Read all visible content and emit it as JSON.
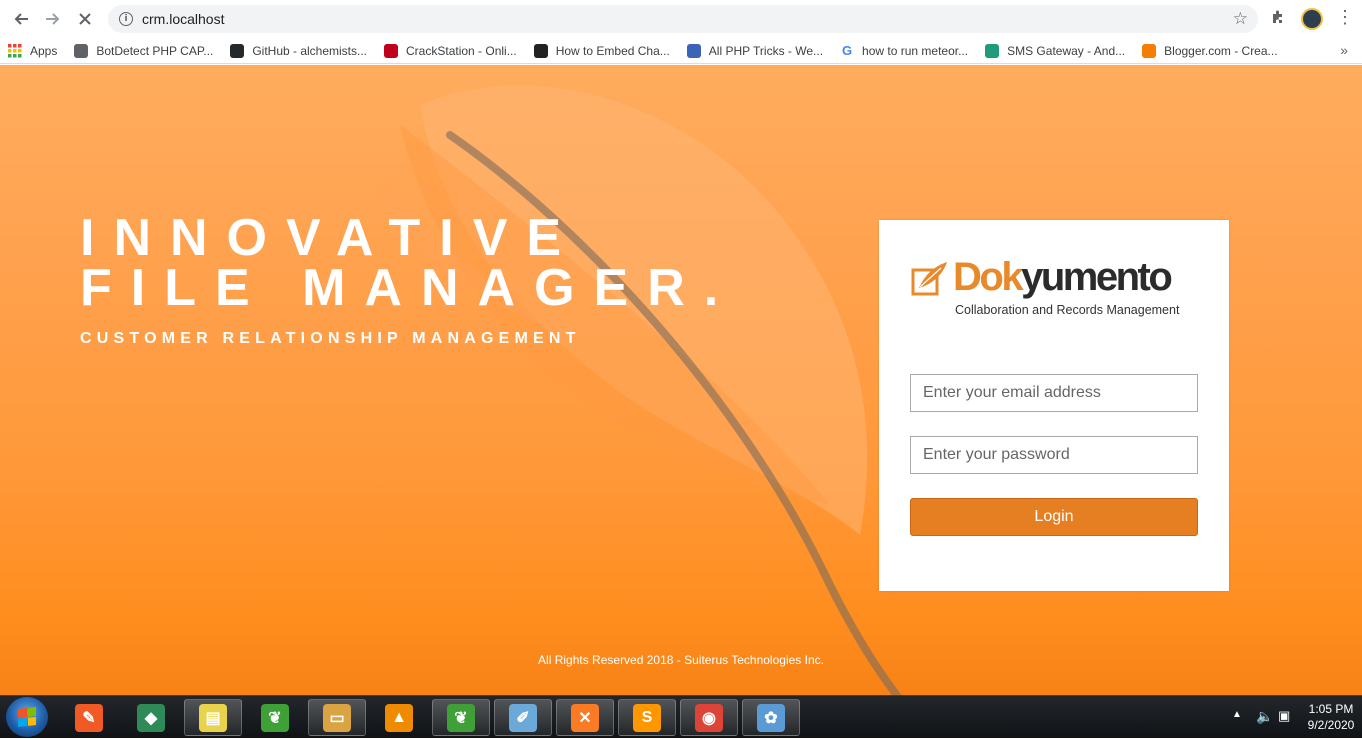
{
  "browser": {
    "url": "crm.localhost",
    "bookmarks": [
      {
        "label": "Apps",
        "icon": "apps-grid-icon",
        "color": "#4285f4"
      },
      {
        "label": "BotDetect PHP CAP...",
        "icon": "globe-icon",
        "color": "#5f6368"
      },
      {
        "label": "GitHub - alchemists...",
        "icon": "github-icon",
        "color": "#24292e"
      },
      {
        "label": "CrackStation - Onli...",
        "icon": "crackstation-icon",
        "color": "#c0001a"
      },
      {
        "label": "How to Embed Cha...",
        "icon": "chart-site-icon",
        "color": "#222222"
      },
      {
        "label": "All PHP Tricks - We...",
        "icon": "php-icon",
        "color": "#3b64b8"
      },
      {
        "label": "how to run meteor...",
        "icon": "google-icon",
        "color": "#4285f4"
      },
      {
        "label": "SMS Gateway - And...",
        "icon": "sms-gateway-icon",
        "color": "#1e9b7b"
      },
      {
        "label": "Blogger.com - Crea...",
        "icon": "blogger-icon",
        "color": "#f57d00"
      }
    ],
    "more_bookmarks": "»"
  },
  "hero": {
    "title_line1": "INNOVATIVE",
    "title_line2": "FILE MANAGER.",
    "subtitle": "CUSTOMER RELATIONSHIP MANAGEMENT"
  },
  "login": {
    "logo_part1": "Dok",
    "logo_part2": "yumento",
    "logo_tagline": "Collaboration and Records Management",
    "email_placeholder": "Enter your email address",
    "password_placeholder": "Enter your password",
    "button_label": "Login"
  },
  "footer": {
    "text": "All Rights Reserved 2018 - Suiterus Technologies Inc."
  },
  "taskbar": {
    "apps": [
      {
        "name": "brave-app-icon",
        "color": "#f15a24",
        "glyph": "✎",
        "open": false
      },
      {
        "name": "git-app-icon",
        "color": "#2e8b57",
        "glyph": "◆",
        "open": false
      },
      {
        "name": "sticky-notes-app-icon",
        "color": "#e8d34a",
        "glyph": "▤",
        "open": true
      },
      {
        "name": "mongodb-app-icon",
        "color": "#3fa037",
        "glyph": "❦",
        "open": false
      },
      {
        "name": "file-explorer-app-icon",
        "color": "#d9a441",
        "glyph": "▭",
        "open": true
      },
      {
        "name": "vlc-app-icon",
        "color": "#f08a00",
        "glyph": "▲",
        "open": false
      },
      {
        "name": "mongodb-compass-app-icon",
        "color": "#3fa037",
        "glyph": "❦",
        "open": true
      },
      {
        "name": "notepad-app-icon",
        "color": "#6aa9d8",
        "glyph": "✐",
        "open": true
      },
      {
        "name": "xampp-app-icon",
        "color": "#fb7a24",
        "glyph": "✕",
        "open": true
      },
      {
        "name": "sublime-text-app-icon",
        "color": "#ff9800",
        "glyph": "S",
        "open": true
      },
      {
        "name": "chrome-app-icon",
        "color": "#db4437",
        "glyph": "◉",
        "open": true
      },
      {
        "name": "paint-app-icon",
        "color": "#5b9bd5",
        "glyph": "✿",
        "open": true
      }
    ],
    "time": "1:05 PM",
    "date": "9/2/2020"
  },
  "colors": {
    "accent": "#e67e22",
    "page_bg_top": "#ffac5e",
    "page_bg_bottom": "#f78216"
  }
}
